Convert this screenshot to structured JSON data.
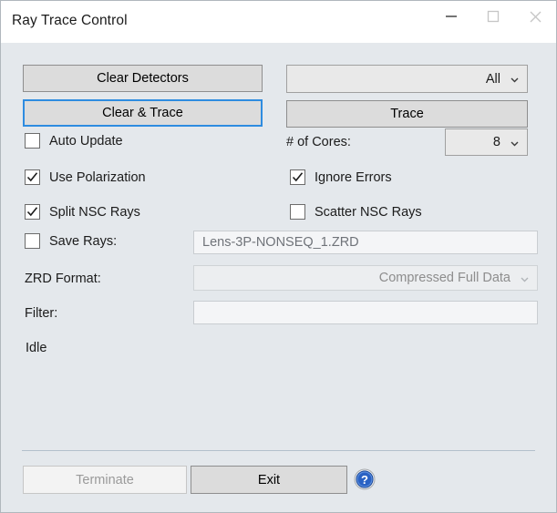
{
  "window": {
    "title": "Ray Trace Control",
    "controls": {
      "minimize": "minimize-icon",
      "maximize": "maximize-icon",
      "close": "close-icon"
    }
  },
  "main": {
    "clear_detectors_button": "Clear Detectors",
    "clear_and_trace_button": "Clear & Trace",
    "trace_button": "Trace",
    "source_select": {
      "value": "All",
      "icon": "chevron-down-icon"
    },
    "auto_update": {
      "label": "Auto Update",
      "checked": false
    },
    "cores": {
      "label": "# of Cores:",
      "value": "8",
      "icon": "chevron-down-icon"
    },
    "use_polarization": {
      "label": "Use Polarization",
      "checked": true
    },
    "ignore_errors": {
      "label": "Ignore Errors",
      "checked": true
    },
    "split_nsc_rays": {
      "label": "Split NSC Rays",
      "checked": true
    },
    "scatter_nsc_rays": {
      "label": "Scatter NSC Rays",
      "checked": false
    },
    "save_rays": {
      "label": "Save Rays:",
      "checked": false,
      "filename": "Lens-3P-NONSEQ_1.ZRD"
    },
    "zrd_format": {
      "label": "ZRD Format:",
      "value": "Compressed Full Data",
      "icon": "chevron-down-icon",
      "disabled": true
    },
    "filter": {
      "label": "Filter:",
      "value": "",
      "disabled": true
    },
    "status": "Idle"
  },
  "footer": {
    "terminate_button": "Terminate",
    "exit_button": "Exit",
    "help_icon": "help-icon"
  },
  "colors": {
    "window_background": "#e4e8ec",
    "titlebar_background": "#ffffff",
    "focus_border": "#2e8ce0",
    "button_face": "#dcdcdc",
    "help_blue": "#1f5fbf",
    "separator": "#b3c0cc"
  }
}
